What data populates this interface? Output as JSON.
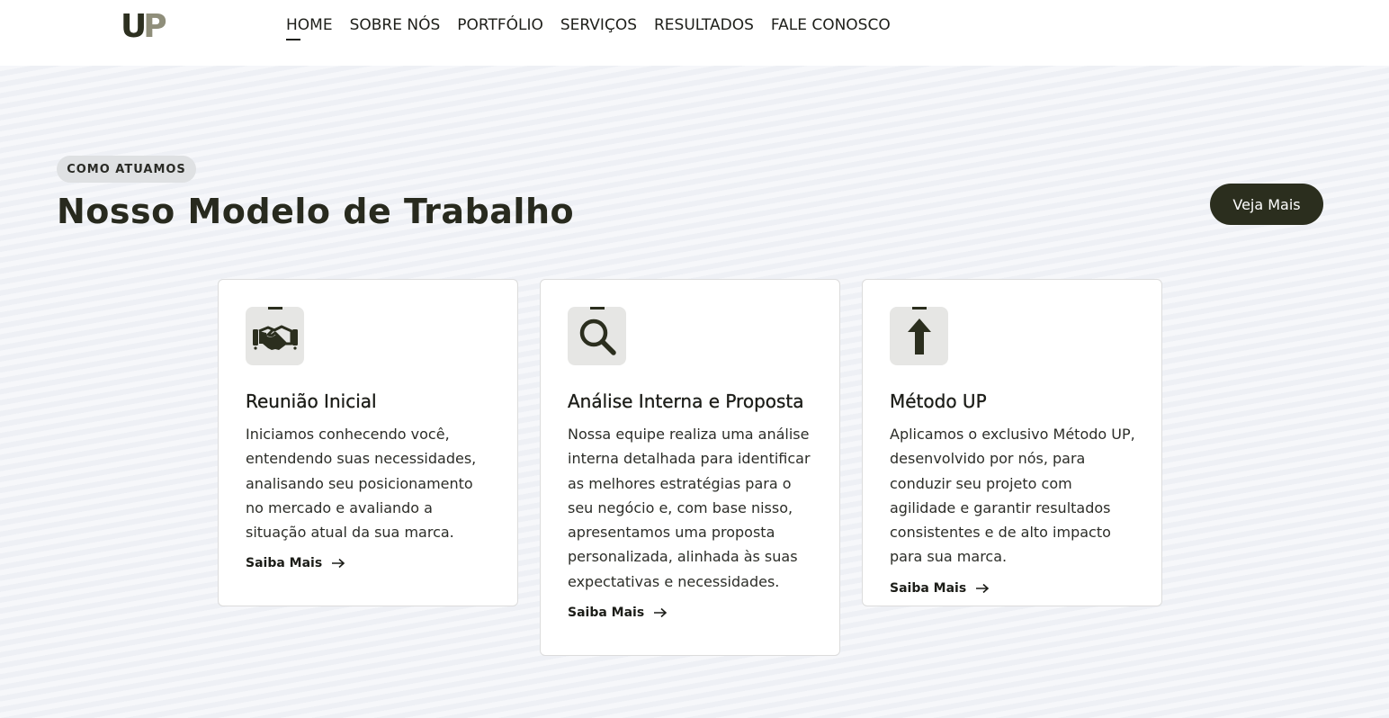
{
  "logo": {
    "letter1": "U",
    "letter2": "P"
  },
  "nav": {
    "items": [
      "HOME",
      "SOBRE NÓS",
      "PORTFÓLIO",
      "SERVIÇOS",
      "RESULTADOS",
      "FALE CONOSCO"
    ],
    "active": "HOME"
  },
  "section": {
    "badge": "COMO ATUAMOS",
    "title": "Nosso Modelo de Trabalho",
    "cta": "Veja Mais"
  },
  "cards": [
    {
      "icon": "handshake-icon",
      "title": "Reunião Inicial",
      "text": "Iniciamos conhecendo você, entendendo suas necessidades, analisando seu posicionamento no mercado e avaliando a situação atual da sua marca.",
      "link": "Saiba Mais"
    },
    {
      "icon": "search-icon",
      "title": "Análise Interna e Proposta",
      "text": "Nossa equipe realiza uma análise interna detalhada para identificar as melhores estratégias para o seu negócio e, com base nisso, apresentamos uma proposta personalizada, alinhada às suas expectativas e necessidades.",
      "link": "Saiba Mais"
    },
    {
      "icon": "arrow-up-icon",
      "title": "Método UP",
      "text": "Aplicamos o exclusivo Método UP, desenvolvido por nós, para conduzir seu projeto com agilidade e garantir resultados consistentes e de alto impacto para sua marca.",
      "link": "Saiba Mais"
    }
  ],
  "colors": {
    "dark": "#2b2e1e",
    "logo_light": "#8f8e7a",
    "background": "#f1f3f7"
  }
}
